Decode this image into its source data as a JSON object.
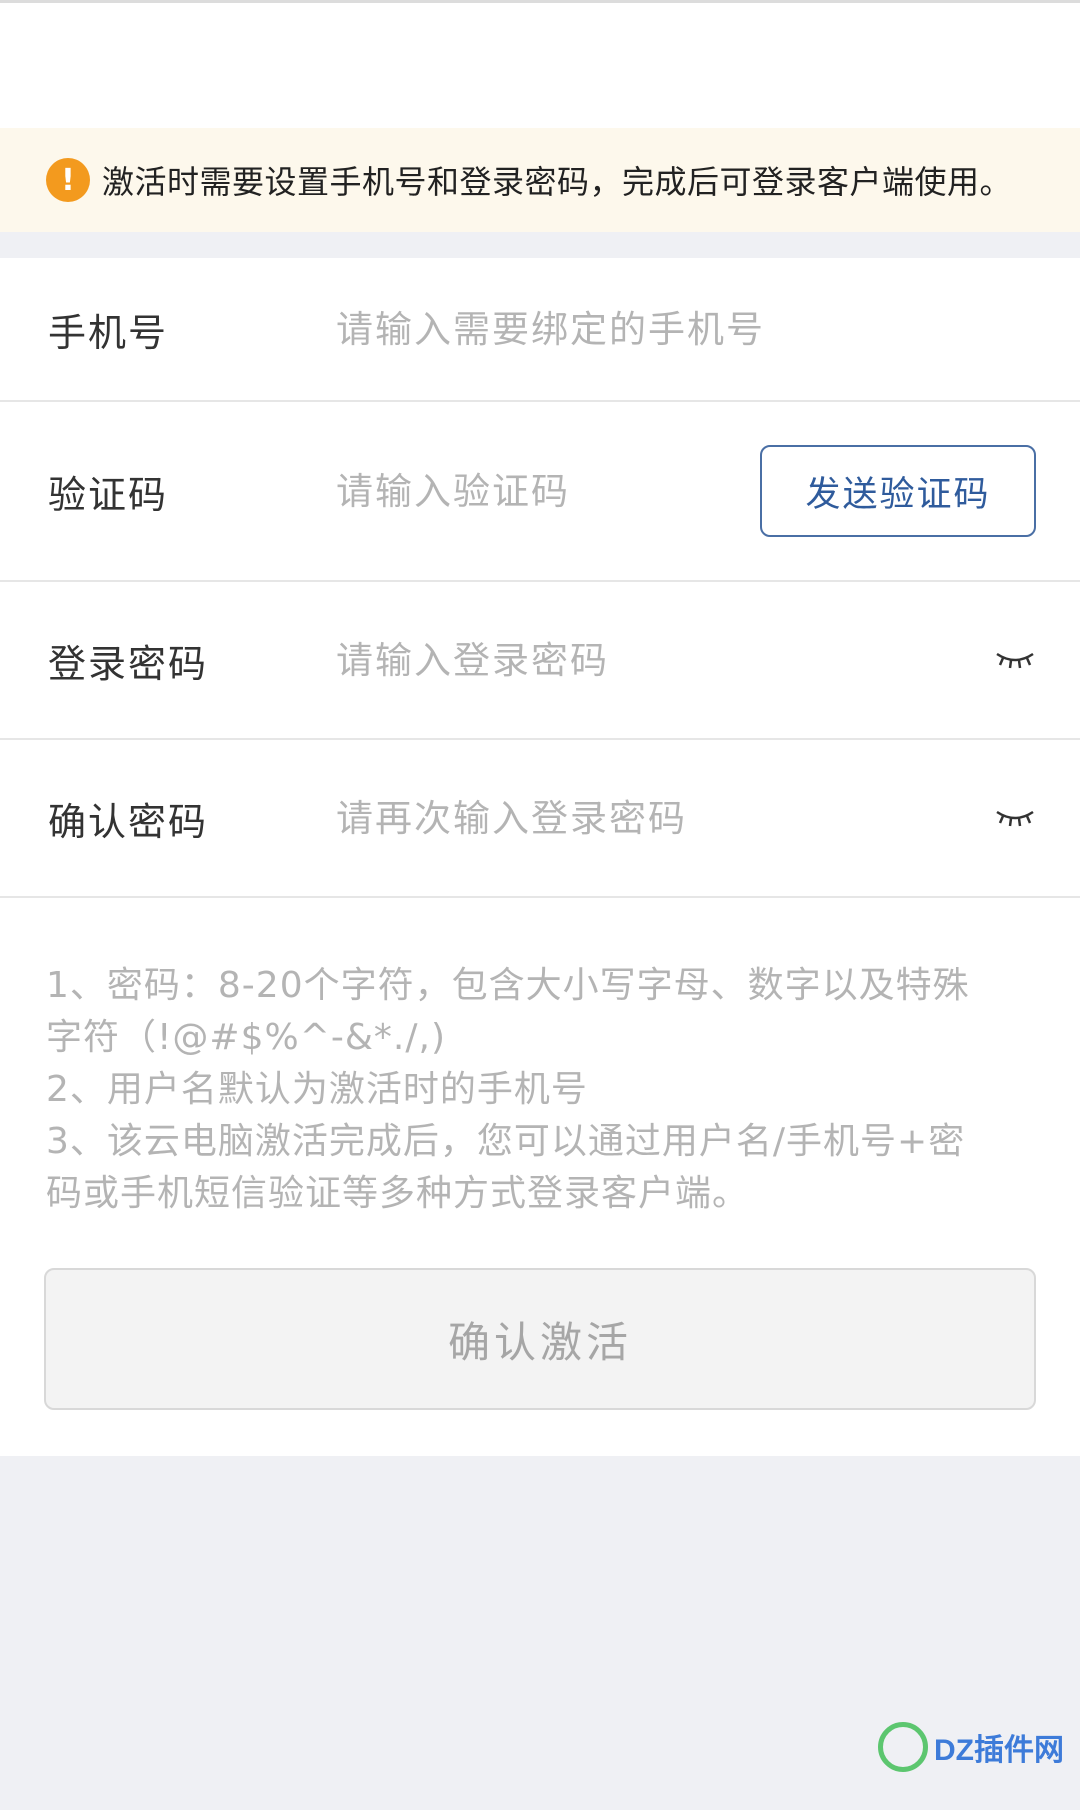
{
  "notice": {
    "icon": "exclamation-icon",
    "text": "激活时需要设置手机号和登录密码，完成后可登录客户端使用。",
    "color": "#f39a1e"
  },
  "form": {
    "phone": {
      "label": "手机号",
      "placeholder": "请输入需要绑定的手机号",
      "value": ""
    },
    "code": {
      "label": "验证码",
      "placeholder": "请输入验证码",
      "value": "",
      "send_label": "发送验证码"
    },
    "password": {
      "label": "登录密码",
      "placeholder": "请输入登录密码",
      "value": "",
      "icon": "eye-closed-icon"
    },
    "confirm": {
      "label": "确认密码",
      "placeholder": "请再次输入登录密码",
      "value": "",
      "icon": "eye-closed-icon"
    }
  },
  "notes": [
    "1、密码：8-20个字符，包含大小写字母、数字以及特殊",
    "字符（!@#$%^-&*./,)",
    "2、用户名默认为激活时的手机号",
    "3、该云电脑激活完成后，您可以通过用户名/手机号+密",
    "码或手机短信验证等多种方式登录客户端。"
  ],
  "submit_label": "确认激活",
  "watermark": {
    "text": "DZ插件网",
    "icon": "dz-logo-icon"
  },
  "colors": {
    "accent": "#2f5b9c",
    "warning": "#f39a1e",
    "placeholder": "#b4b4b4"
  }
}
